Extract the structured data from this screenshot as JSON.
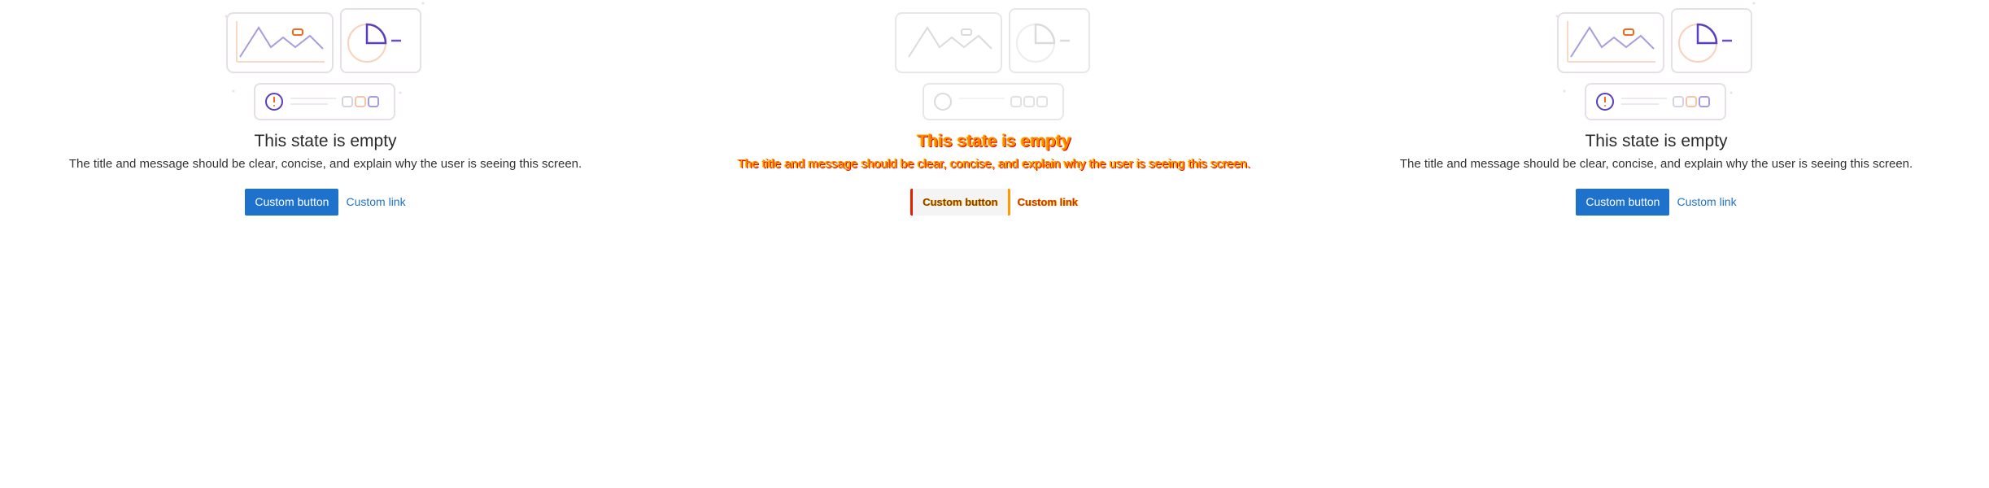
{
  "empty_states": [
    {
      "title": "This state is empty",
      "message": "The title and message should be clear, concise, and explain why the user is seeing this screen.",
      "button_label": "Custom button",
      "link_label": "Custom link"
    },
    {
      "title": "This state is empty",
      "message": "The title and message should be clear, concise, and explain why the user is seeing this screen.",
      "button_label": "Custom button",
      "link_label": "Custom link"
    },
    {
      "title": "This state is empty",
      "message": "The title and message should be clear, concise, and explain why the user is seeing this screen.",
      "button_label": "Custom button",
      "link_label": "Custom link"
    }
  ],
  "colors": {
    "accent": "#1f72cc",
    "illustration_purple": "#6b4fc9",
    "illustration_orange": "#f26b1d",
    "illustration_border": "#e2dde6"
  },
  "icons": [
    "empty-state-illustration-icon",
    "line-chart-icon",
    "pie-chart-icon",
    "alert-icon"
  ]
}
